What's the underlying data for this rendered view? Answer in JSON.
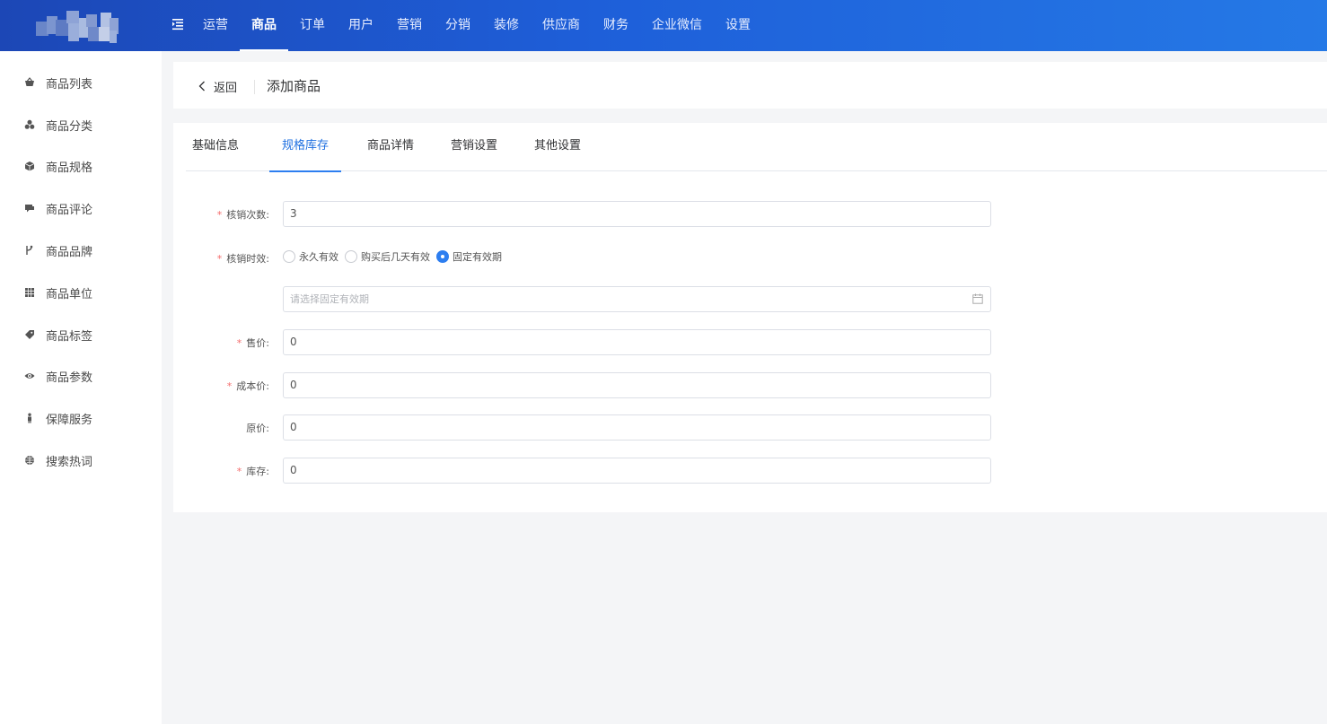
{
  "header": {
    "nav": [
      {
        "label": "运营",
        "active": false
      },
      {
        "label": "商品",
        "active": true
      },
      {
        "label": "订单",
        "active": false
      },
      {
        "label": "用户",
        "active": false
      },
      {
        "label": "营销",
        "active": false
      },
      {
        "label": "分销",
        "active": false
      },
      {
        "label": "装修",
        "active": false
      },
      {
        "label": "供应商",
        "active": false
      },
      {
        "label": "财务",
        "active": false
      },
      {
        "label": "企业微信",
        "active": false
      },
      {
        "label": "设置",
        "active": false
      }
    ],
    "menu_icon": "menu-fold-icon",
    "accent": "#1e5fd9"
  },
  "sidebar": {
    "items": [
      {
        "label": "商品列表",
        "icon": "basket-icon"
      },
      {
        "label": "商品分类",
        "icon": "category-icon"
      },
      {
        "label": "商品规格",
        "icon": "cube-icon"
      },
      {
        "label": "商品评论",
        "icon": "comment-icon"
      },
      {
        "label": "商品品牌",
        "icon": "brand-icon"
      },
      {
        "label": "商品单位",
        "icon": "grid-icon"
      },
      {
        "label": "商品标签",
        "icon": "tag-icon"
      },
      {
        "label": "商品参数",
        "icon": "eye-icon"
      },
      {
        "label": "保障服务",
        "icon": "person-icon"
      },
      {
        "label": "搜索热词",
        "icon": "globe-icon"
      }
    ]
  },
  "page_head": {
    "back_label": "返回",
    "title": "添加商品"
  },
  "tabs": [
    {
      "label": "基础信息",
      "active": false
    },
    {
      "label": "规格库存",
      "active": true
    },
    {
      "label": "商品详情",
      "active": false
    },
    {
      "label": "营销设置",
      "active": false
    },
    {
      "label": "其他设置",
      "active": false
    }
  ],
  "form": {
    "verify_count": {
      "label": "核销次数:",
      "value": "3",
      "required": true
    },
    "verify_validity": {
      "label": "核销时效:",
      "required": true,
      "options": [
        {
          "label": "永久有效",
          "checked": false
        },
        {
          "label": "购买后几天有效",
          "checked": false
        },
        {
          "label": "固定有效期",
          "checked": true
        }
      ]
    },
    "fixed_period": {
      "placeholder": "请选择固定有效期",
      "icon": "calendar-icon"
    },
    "price": {
      "label": "售价:",
      "value": "0",
      "required": true
    },
    "cost_price": {
      "label": "成本价:",
      "value": "0",
      "required": true
    },
    "original_price": {
      "label": "原价:",
      "value": "0",
      "required": false
    },
    "stock": {
      "label": "库存:",
      "value": "0",
      "required": true
    },
    "required_mark": "*"
  }
}
